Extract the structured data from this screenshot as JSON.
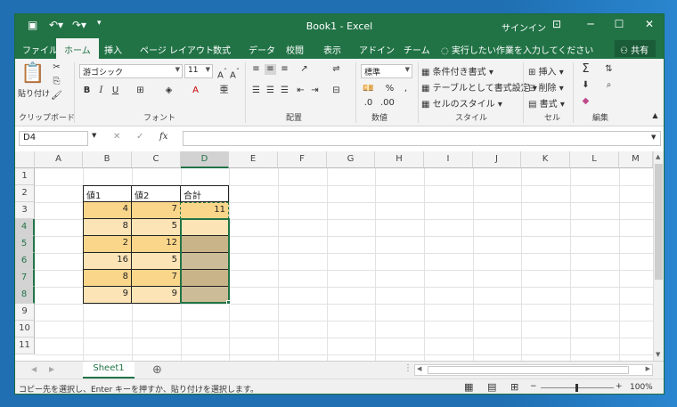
{
  "title": "Book1 - Excel",
  "signin": "サインイン",
  "tabs": [
    "ファイル",
    "ホーム",
    "挿入",
    "ページ レイアウト",
    "数式",
    "データ",
    "校閲",
    "表示",
    "アドイン",
    "チーム"
  ],
  "tell_me": "実行したい作業を入力してください",
  "share": "共有",
  "ribbon": {
    "paste": "貼り付け",
    "font_name": "游ゴシック",
    "font_size": "11",
    "number_format": "標準",
    "cond_format": "条件付き書式",
    "table_format": "テーブルとして書式設定",
    "cell_style": "セルのスタイル",
    "insert": "挿入",
    "delete": "削除",
    "format": "書式",
    "groups": {
      "clipboard": "クリップボード",
      "font": "フォント",
      "alignment": "配置",
      "number": "数値",
      "style": "スタイル",
      "cells": "セル",
      "editing": "編集"
    }
  },
  "namebox": "D4",
  "fx": "fx",
  "columns": [
    "A",
    "B",
    "C",
    "D",
    "E",
    "F",
    "G",
    "H",
    "I",
    "J",
    "K",
    "L",
    "M"
  ],
  "rows": [
    "1",
    "2",
    "3",
    "4",
    "5",
    "6",
    "7",
    "8",
    "9",
    "10",
    "11"
  ],
  "headers": {
    "b": "値1",
    "c": "値2",
    "d": "合計"
  },
  "data": [
    {
      "b": "4",
      "c": "7",
      "d": "11"
    },
    {
      "b": "8",
      "c": "5",
      "d": ""
    },
    {
      "b": "2",
      "c": "12",
      "d": ""
    },
    {
      "b": "16",
      "c": "5",
      "d": ""
    },
    {
      "b": "8",
      "c": "7",
      "d": ""
    },
    {
      "b": "9",
      "c": "9",
      "d": ""
    }
  ],
  "sheet": "Sheet1",
  "status": "コピー先を選択し、Enter キーを押すか、貼り付けを選択します。",
  "zoom": "100%",
  "colors": {
    "excel_green": "#217346",
    "light_yellow": "#fce4b6",
    "orange_yellow": "#fad68a",
    "selection_tan": "#c9b489"
  }
}
